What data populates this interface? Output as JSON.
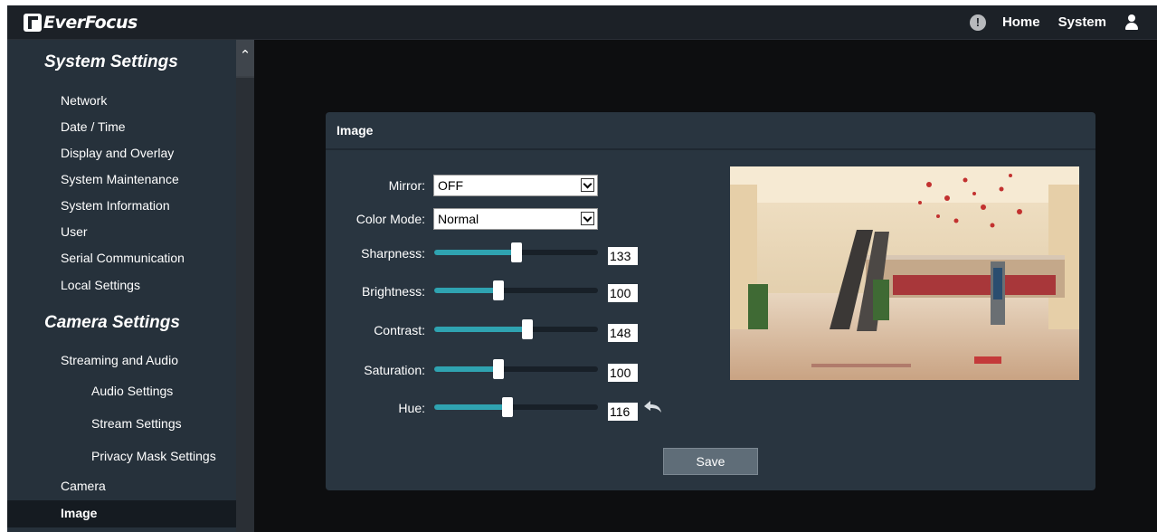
{
  "header": {
    "logo_text": "EverFocus",
    "home_label": "Home",
    "system_label": "System"
  },
  "sidebar": {
    "system_settings_title": "System Settings",
    "system_items": [
      "Network",
      "Date / Time",
      "Display and Overlay",
      "System Maintenance",
      "System Information",
      "User",
      "Serial Communication",
      "Local Settings"
    ],
    "camera_settings_title": "Camera Settings",
    "streaming_and_audio": "Streaming and Audio",
    "streaming_subitems": [
      "Audio Settings",
      "Stream Settings",
      "Privacy Mask Settings"
    ],
    "camera": "Camera",
    "image": "Image",
    "active_item": "Image"
  },
  "panel": {
    "title": "Image",
    "mirror": {
      "label": "Mirror:",
      "value": "OFF"
    },
    "color_mode": {
      "label": "Color Mode:",
      "value": "Normal"
    },
    "sliders": [
      {
        "label": "Sharpness:",
        "value": "133",
        "fraction": 0.5
      },
      {
        "label": "Brightness:",
        "value": "100",
        "fraction": 0.39
      },
      {
        "label": "Contrast:",
        "value": "148",
        "fraction": 0.57
      },
      {
        "label": "Saturation:",
        "value": "100",
        "fraction": 0.39
      },
      {
        "label": "Hue:",
        "value": "116",
        "fraction": 0.45
      }
    ],
    "save_label": "Save"
  },
  "colors": {
    "accent": "#2fa3b1",
    "panel_bg": "#293540",
    "sidebar_bg": "#26313b",
    "topbar_bg": "#1c2127"
  },
  "icons": [
    "alert-icon",
    "user-icon",
    "scroll-up-icon",
    "chevron-down-icon",
    "undo-icon"
  ]
}
